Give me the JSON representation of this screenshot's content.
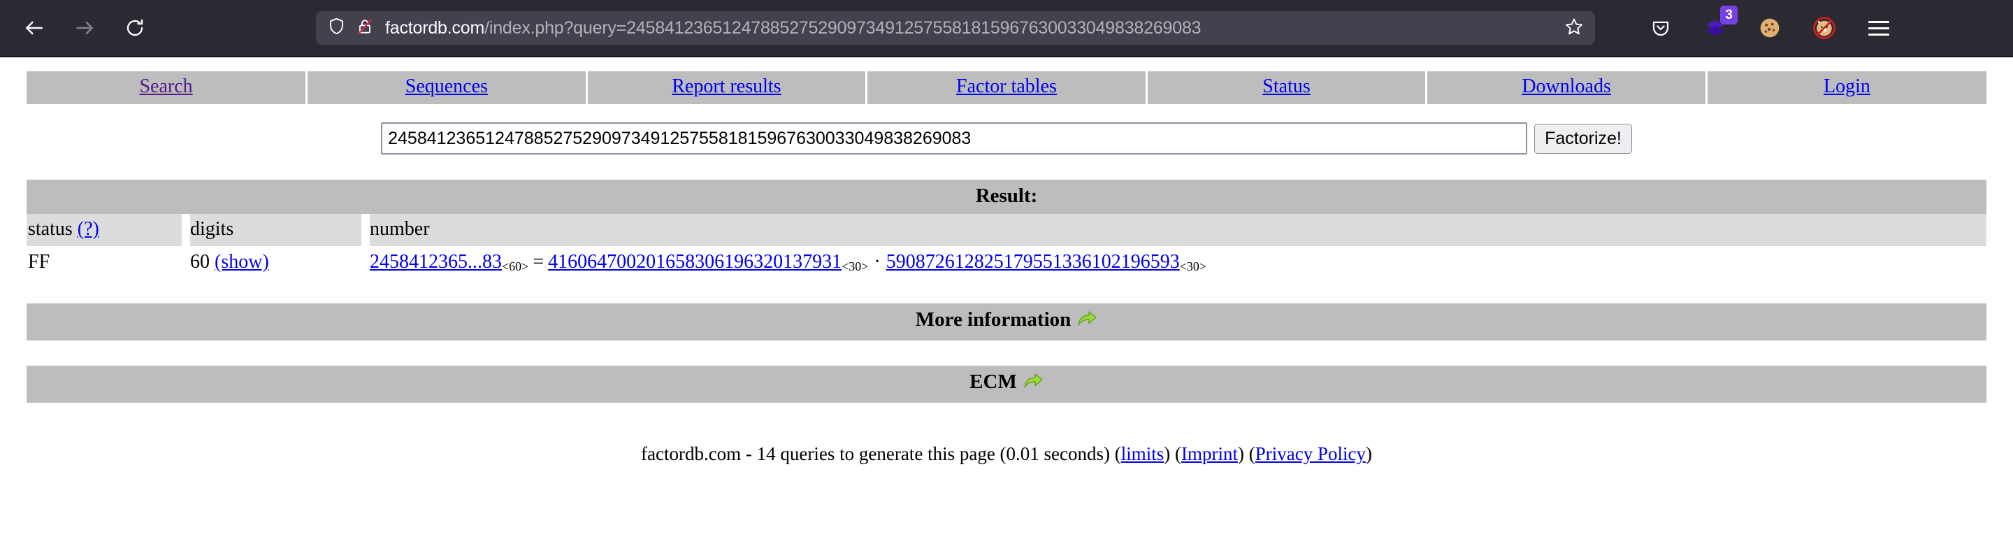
{
  "browser": {
    "url_host": "factordb.com",
    "url_path": "/index.php?query=245841236512478852752909734912575581815967630033049838269083",
    "back_icon": "back-arrow-icon",
    "forward_icon": "forward-arrow-icon",
    "reload_icon": "reload-icon",
    "shield_icon": "tracking-protection-shield-icon",
    "lock_icon": "insecure-connection-lock-icon",
    "bookmark_icon": "bookmark-star-icon",
    "pocket_icon": "pocket-save-icon",
    "extension_badge": "3",
    "menu_icon": "hamburger-menu-icon",
    "accent_purple": "#7542e5",
    "chrome_bg": "#2b2a33",
    "urlbar_bg": "#42414d"
  },
  "nav": {
    "items": [
      {
        "label": "Search",
        "visited": true
      },
      {
        "label": "Sequences",
        "visited": false
      },
      {
        "label": "Report results",
        "visited": false
      },
      {
        "label": "Factor tables",
        "visited": false
      },
      {
        "label": "Status",
        "visited": false
      },
      {
        "label": "Downloads",
        "visited": false
      },
      {
        "label": "Login",
        "visited": false
      }
    ]
  },
  "search": {
    "value": "245841236512478852752909734912575581815967630033049838269083",
    "placeholder": "",
    "submit_label": "Factorize!"
  },
  "result": {
    "heading": "Result:",
    "columns": {
      "status": "status",
      "status_help": "(?)",
      "digits": "digits",
      "number": "number"
    },
    "row": {
      "status": "FF",
      "digits": "60",
      "show_label": "(show)",
      "number_short": "2458412365...83",
      "number_digits": "<60>",
      "equals": "=",
      "factor1": "416064700201658306196320137931",
      "factor1_digits": "<30>",
      "multiply": "·",
      "factor2": "590872612825179551336102196593",
      "factor2_digits": "<30>"
    }
  },
  "sections": [
    {
      "title": "More information",
      "icon": "green-right-arrow-icon"
    },
    {
      "title": "ECM",
      "icon": "green-right-arrow-icon"
    }
  ],
  "footer": {
    "text": "factordb.com - 14 queries to generate this page (0.01 seconds) (",
    "limits": "limits",
    "sep1": ") (",
    "imprint": "Imprint",
    "sep2": ") (",
    "privacy": "Privacy Policy",
    "sep3": ")"
  },
  "colors": {
    "bar_gray": "#bdbdbd",
    "colhead_gray": "#dcdcdc",
    "link_blue": "#0000ee",
    "link_visited": "#551a8b",
    "arrow_green": "#8cc63f"
  }
}
